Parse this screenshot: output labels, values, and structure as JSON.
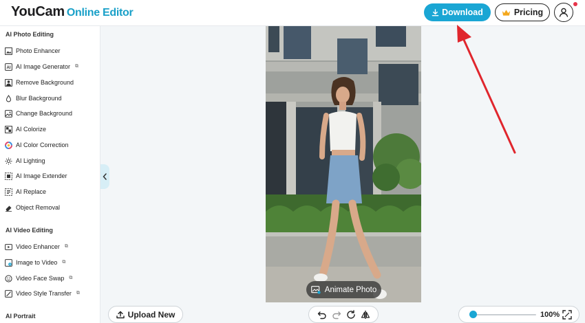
{
  "header": {
    "logo_main": "YouCam",
    "logo_sub": "Online Editor",
    "download_label": "Download",
    "pricing_label": "Pricing"
  },
  "sidebar": {
    "photo_section": "AI Photo Editing",
    "photo_items": [
      {
        "label": "Photo Enhancer",
        "icon": "photo-enhancer-icon",
        "external": false
      },
      {
        "label": "AI Image Generator",
        "icon": "image-generator-icon",
        "external": true
      },
      {
        "label": "Remove Background",
        "icon": "remove-background-icon",
        "external": false
      },
      {
        "label": "Blur Background",
        "icon": "blur-icon",
        "external": false
      },
      {
        "label": "Change Background",
        "icon": "change-background-icon",
        "external": false
      },
      {
        "label": "AI Colorize",
        "icon": "colorize-icon",
        "external": false
      },
      {
        "label": "AI Color Correction",
        "icon": "color-wheel-icon",
        "external": false
      },
      {
        "label": "AI Lighting",
        "icon": "lighting-icon",
        "external": false
      },
      {
        "label": "AI Image Extender",
        "icon": "extender-icon",
        "external": false
      },
      {
        "label": "AI Replace",
        "icon": "replace-icon",
        "external": false
      },
      {
        "label": "Object Removal",
        "icon": "eraser-icon",
        "external": false
      }
    ],
    "video_section": "AI Video Editing",
    "video_items": [
      {
        "label": "Video Enhancer",
        "icon": "video-enhancer-icon",
        "external": true
      },
      {
        "label": "Image to Video",
        "icon": "image-to-video-icon",
        "external": true
      },
      {
        "label": "Video Face Swap",
        "icon": "face-swap-icon",
        "external": true
      },
      {
        "label": "Video Style Transfer",
        "icon": "style-transfer-icon",
        "external": true
      }
    ],
    "portrait_section": "AI Portrait"
  },
  "canvas": {
    "animate_label": "Animate Photo"
  },
  "bottom": {
    "upload_label": "Upload New",
    "zoom_value": "100%",
    "zoom_level": 0.05
  },
  "colors": {
    "accent": "#1aa6d4",
    "arrow": "#e0262d",
    "notification": "#e8344a"
  },
  "external_mark": "⧉"
}
